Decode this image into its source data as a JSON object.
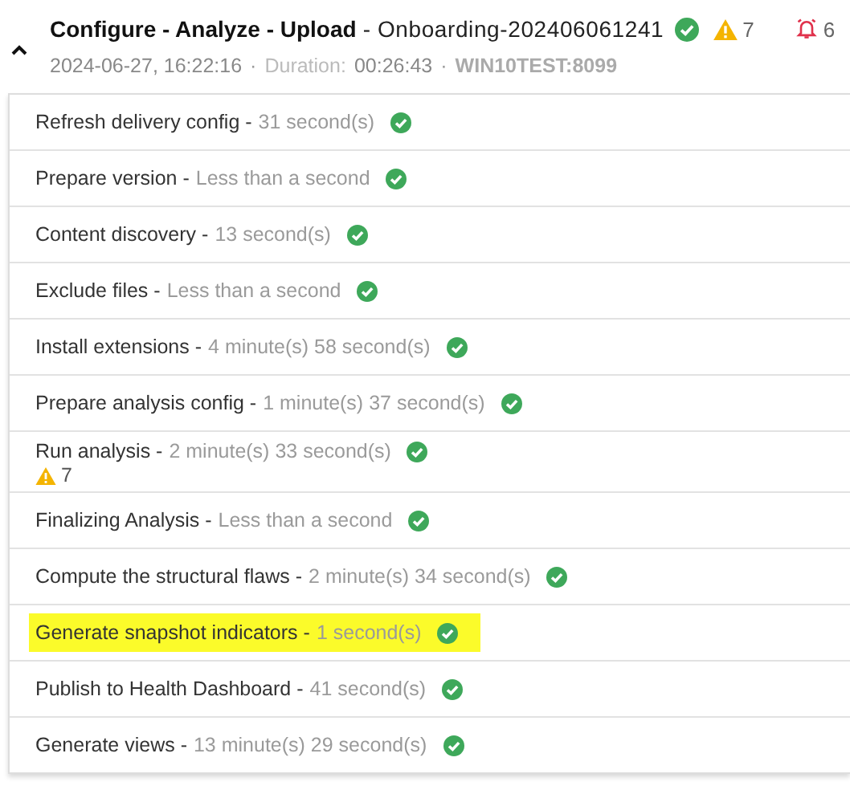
{
  "header": {
    "expanded": true,
    "title": "Configure - Analyze - Upload",
    "subtitle": "- Onboarding-202406061241",
    "succeeded": true,
    "warnings": "7",
    "alarms": "6",
    "meta": [
      {
        "kind": "date",
        "text": "2024-06-27, 16:22:16"
      },
      {
        "kind": "sep",
        "text": "·"
      },
      {
        "kind": "label",
        "text": "Duration:"
      },
      {
        "kind": "value",
        "text": "00:26:43"
      },
      {
        "kind": "sep",
        "text": "·"
      },
      {
        "kind": "host",
        "text": "WIN10TEST:8099"
      }
    ]
  },
  "steps": [
    {
      "name": "Refresh delivery config -",
      "duration": "31 second(s)",
      "succeeded": true,
      "highlighted": false
    },
    {
      "name": "Prepare version -",
      "duration": "Less than a second",
      "succeeded": true,
      "highlighted": false
    },
    {
      "name": "Content discovery -",
      "duration": "13 second(s)",
      "succeeded": true,
      "highlighted": false
    },
    {
      "name": "Exclude files -",
      "duration": "Less than a second",
      "succeeded": true,
      "highlighted": false
    },
    {
      "name": "Install extensions -",
      "duration": "4 minute(s) 58 second(s)",
      "succeeded": true,
      "highlighted": false
    },
    {
      "name": "Prepare analysis config -",
      "duration": "1 minute(s) 37 second(s)",
      "succeeded": true,
      "highlighted": false
    },
    {
      "name": "Run analysis -",
      "duration": "2 minute(s) 33 second(s)",
      "succeeded": true,
      "highlighted": false,
      "warnings": "7"
    },
    {
      "name": "Finalizing Analysis -",
      "duration": "Less than a second",
      "succeeded": true,
      "highlighted": false
    },
    {
      "name": "Compute the structural flaws -",
      "duration": "2 minute(s) 34 second(s)",
      "succeeded": true,
      "highlighted": false
    },
    {
      "name": "Generate snapshot indicators -",
      "duration": "1 second(s)",
      "succeeded": true,
      "highlighted": true
    },
    {
      "name": "Publish to Health Dashboard -",
      "duration": "41 second(s)",
      "succeeded": true,
      "highlighted": false
    },
    {
      "name": "Generate views -",
      "duration": "13 minute(s) 29 second(s)",
      "succeeded": true,
      "highlighted": false
    }
  ]
}
